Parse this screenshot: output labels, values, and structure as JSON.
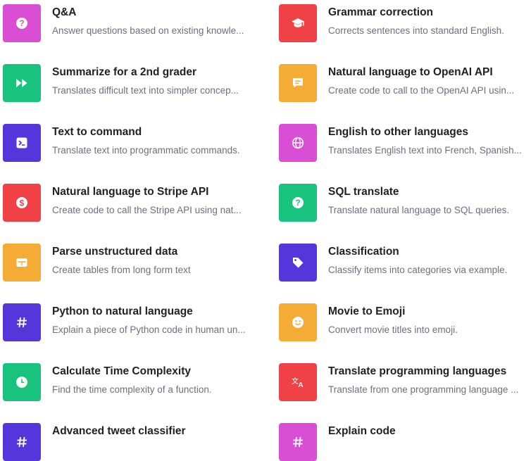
{
  "colors": {
    "magenta": "#d94ed5",
    "red": "#ef4146",
    "green": "#19c37d",
    "orange": "#f4ac36",
    "purple": "#5436da",
    "title_text": "#202123",
    "desc_text": "#6e6e80"
  },
  "examples": [
    {
      "title": "Q&A",
      "description": "Answer questions based on existing knowle...",
      "color": "#d94ed5",
      "icon": "question-icon"
    },
    {
      "title": "Grammar correction",
      "description": "Corrects sentences into standard English.",
      "color": "#ef4146",
      "icon": "graduation-cap-icon"
    },
    {
      "title": "Summarize for a 2nd grader",
      "description": "Translates difficult text into simpler concep...",
      "color": "#19c37d",
      "icon": "fast-forward-icon"
    },
    {
      "title": "Natural language to OpenAI API",
      "description": "Create code to call to the OpenAI API usin...",
      "color": "#f4ac36",
      "icon": "message-icon"
    },
    {
      "title": "Text to command",
      "description": "Translate text into programmatic commands.",
      "color": "#5436da",
      "icon": "terminal-icon"
    },
    {
      "title": "English to other languages",
      "description": "Translates English text into French, Spanish...",
      "color": "#d94ed5",
      "icon": "globe-icon"
    },
    {
      "title": "Natural language to Stripe API",
      "description": "Create code to call the Stripe API using nat...",
      "color": "#ef4146",
      "icon": "dollar-icon"
    },
    {
      "title": "SQL translate",
      "description": "Translate natural language to SQL queries.",
      "color": "#19c37d",
      "icon": "question-icon"
    },
    {
      "title": "Parse unstructured data",
      "description": "Create tables from long form text",
      "color": "#f4ac36",
      "icon": "table-icon"
    },
    {
      "title": "Classification",
      "description": "Classify items into categories via example.",
      "color": "#5436da",
      "icon": "tag-icon"
    },
    {
      "title": "Python to natural language",
      "description": "Explain a piece of Python code in human un...",
      "color": "#5436da",
      "icon": "hashtag-icon"
    },
    {
      "title": "Movie to Emoji",
      "description": "Convert movie titles into emoji.",
      "color": "#f4ac36",
      "icon": "smile-icon"
    },
    {
      "title": "Calculate Time Complexity",
      "description": "Find the time complexity of a function.",
      "color": "#19c37d",
      "icon": "clock-icon"
    },
    {
      "title": "Translate programming languages",
      "description": "Translate from one programming language ...",
      "color": "#ef4146",
      "icon": "translate-icon"
    },
    {
      "title": "Advanced tweet classifier",
      "description": "",
      "color": "#5436da",
      "icon": "hashtag-icon"
    },
    {
      "title": "Explain code",
      "description": "",
      "color": "#d94ed5",
      "icon": "hashtag-icon"
    }
  ]
}
